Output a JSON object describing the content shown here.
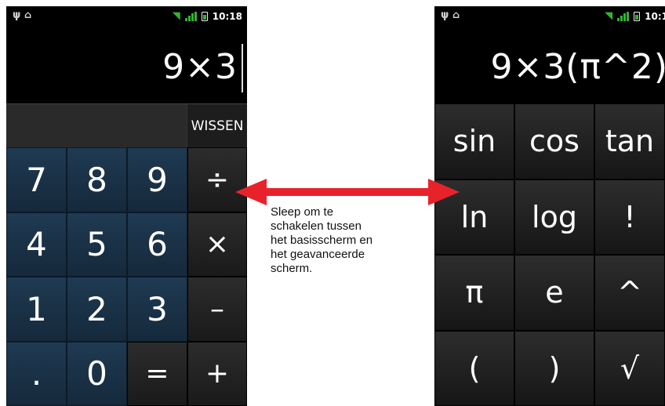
{
  "colors": {
    "accent": "#e8222b",
    "digit_key": "#1f3a52",
    "operator_key": "#222222",
    "status_green": "#34b233"
  },
  "left_screen": {
    "status": {
      "usb_icon": "usb-icon",
      "debug_icon": "android-debug-icon",
      "time": "10:18"
    },
    "display": "9×3",
    "clear_label": "WISSEN",
    "keys": [
      {
        "label": "7",
        "kind": "digit"
      },
      {
        "label": "8",
        "kind": "digit"
      },
      {
        "label": "9",
        "kind": "digit"
      },
      {
        "label": "÷",
        "kind": "op"
      },
      {
        "label": "4",
        "kind": "digit"
      },
      {
        "label": "5",
        "kind": "digit"
      },
      {
        "label": "6",
        "kind": "digit"
      },
      {
        "label": "×",
        "kind": "op"
      },
      {
        "label": "1",
        "kind": "digit"
      },
      {
        "label": "2",
        "kind": "digit"
      },
      {
        "label": "3",
        "kind": "digit"
      },
      {
        "label": "–",
        "kind": "op"
      },
      {
        "label": ".",
        "kind": "digit"
      },
      {
        "label": "0",
        "kind": "digit"
      },
      {
        "label": "=",
        "kind": "op"
      },
      {
        "label": "+",
        "kind": "op"
      }
    ]
  },
  "right_screen": {
    "status": {
      "time": "10:1"
    },
    "display": "9×3(π^2)",
    "keys": [
      "sin",
      "cos",
      "tan",
      "ln",
      "log",
      "!",
      "π",
      "e",
      "^",
      "(",
      ")",
      "√"
    ]
  },
  "caption": {
    "lines": [
      "Sleep om te",
      "schakelen tussen",
      "het basisscherm en",
      "het geavanceerde",
      "scherm."
    ]
  }
}
